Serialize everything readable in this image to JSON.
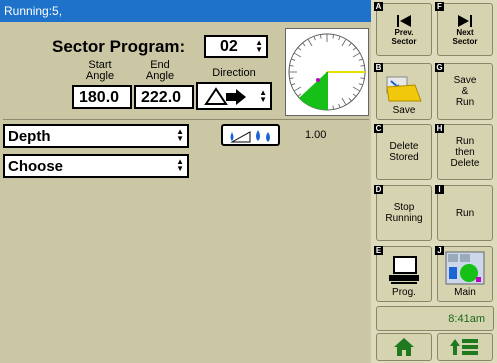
{
  "status": {
    "text": "Running:5,"
  },
  "sector": {
    "title": "Sector Program:",
    "program_number": "02",
    "start_label": "Start\nAngle",
    "end_label": "End\nAngle",
    "direction_label": "Direction",
    "start_value": "180.0",
    "end_value": "222.0"
  },
  "depth": {
    "selected": "Depth",
    "value": "1.00"
  },
  "choose": {
    "selected": "Choose"
  },
  "buttons": {
    "prev_sector": {
      "key": "A",
      "label": "Prev.\nSector"
    },
    "next_sector": {
      "key": "F",
      "label": "Next\nSector"
    },
    "save": {
      "key": "B",
      "label": "Save"
    },
    "save_run": {
      "key": "G",
      "label": "Save\n&\nRun"
    },
    "delete_stored": {
      "key": "C",
      "label": "Delete\nStored"
    },
    "run_then_delete": {
      "key": "H",
      "label": "Run\nthen\nDelete"
    },
    "stop_running": {
      "key": "D",
      "label": "Stop\nRunning"
    },
    "run": {
      "key": "I",
      "label": "Run"
    },
    "prog": {
      "key": "E",
      "label": "Prog."
    },
    "main": {
      "key": "J",
      "label": "Main"
    }
  },
  "time": "8:41am",
  "icons": {
    "prev": "skip-previous-icon",
    "next": "skip-next-icon",
    "save": "folder-save-icon",
    "prog": "computer-icon",
    "main": "dashboard-icon",
    "home": "home-icon",
    "menu": "up-menu-icon"
  },
  "colors": {
    "status_bar": "#1f72c9",
    "panel_bg": "#cbc7a4",
    "sector_fill": "#16c016",
    "heading_line": "#e6e000"
  }
}
